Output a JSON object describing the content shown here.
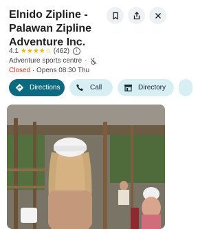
{
  "place": {
    "name": "Elnido Zipline - Palawan Zipline Adventure Inc.",
    "rating": "4.1",
    "stars": "★★★★☆",
    "review_count": "(462)",
    "info_symbol": "i",
    "category": "Adventure sports centre",
    "separator": "·",
    "status": "Closed",
    "hours": " · Opens 08:30 Thu"
  },
  "actions": {
    "save_icon": "bookmark-icon",
    "share_icon": "share-icon",
    "close_icon": "close-icon"
  },
  "chips": {
    "directions": "Directions",
    "call": "Call",
    "directory": "Directory"
  },
  "colors": {
    "primary_chip": "#0b6a7f",
    "secondary_chip": "#d7eef3",
    "star": "#f6b402",
    "closed": "#d93025"
  }
}
